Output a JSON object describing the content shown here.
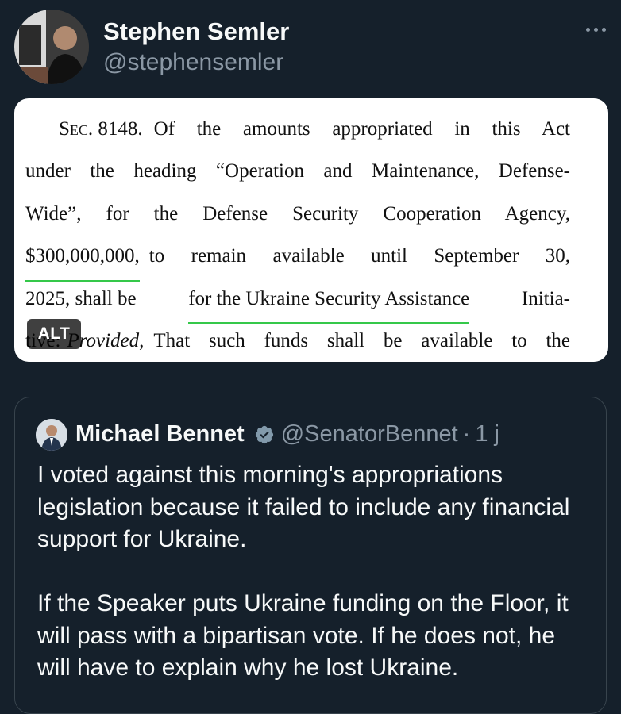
{
  "post": {
    "author_name": "Stephen Semler",
    "author_handle": "@stephensemler",
    "more_icon": "more-horizontal-icon"
  },
  "media": {
    "alt_badge": "ALT",
    "document_lines": [
      [
        "Sec. 8148.",
        "Of the amounts appropriated in this Act"
      ],
      [
        "under the heading “Operation and Maintenance, Defense-"
      ],
      [
        "Wide”, for the Defense Security Cooperation Agency,"
      ],
      [
        "$300,000,000,",
        "to remain available until September 30,"
      ],
      [
        "2025, shall be",
        "for the Ukraine Security Assistance",
        "Initia-"
      ],
      [
        "tive:",
        "Provided,",
        "That such funds shall be available to the"
      ]
    ],
    "highlight_color": "#35c84a"
  },
  "quoted_post": {
    "author_name": "Michael Bennet",
    "author_handle": "@SenatorBennet",
    "separator": "·",
    "time": "1 j",
    "verified_icon": "verified-badge-icon",
    "verified_color": "#829aab",
    "paragraphs": [
      "I voted against this morning's appropriations legislation because it failed to include any financial support for Ukraine.",
      "If the Speaker puts Ukraine funding on the Floor, it will pass with a bipartisan vote. If he does not, he will have to explain why he lost Ukraine."
    ]
  },
  "colors": {
    "background": "#15202b",
    "primary_text": "#f7f9f9",
    "secondary_text": "#8b98a5",
    "border": "#38444d"
  }
}
